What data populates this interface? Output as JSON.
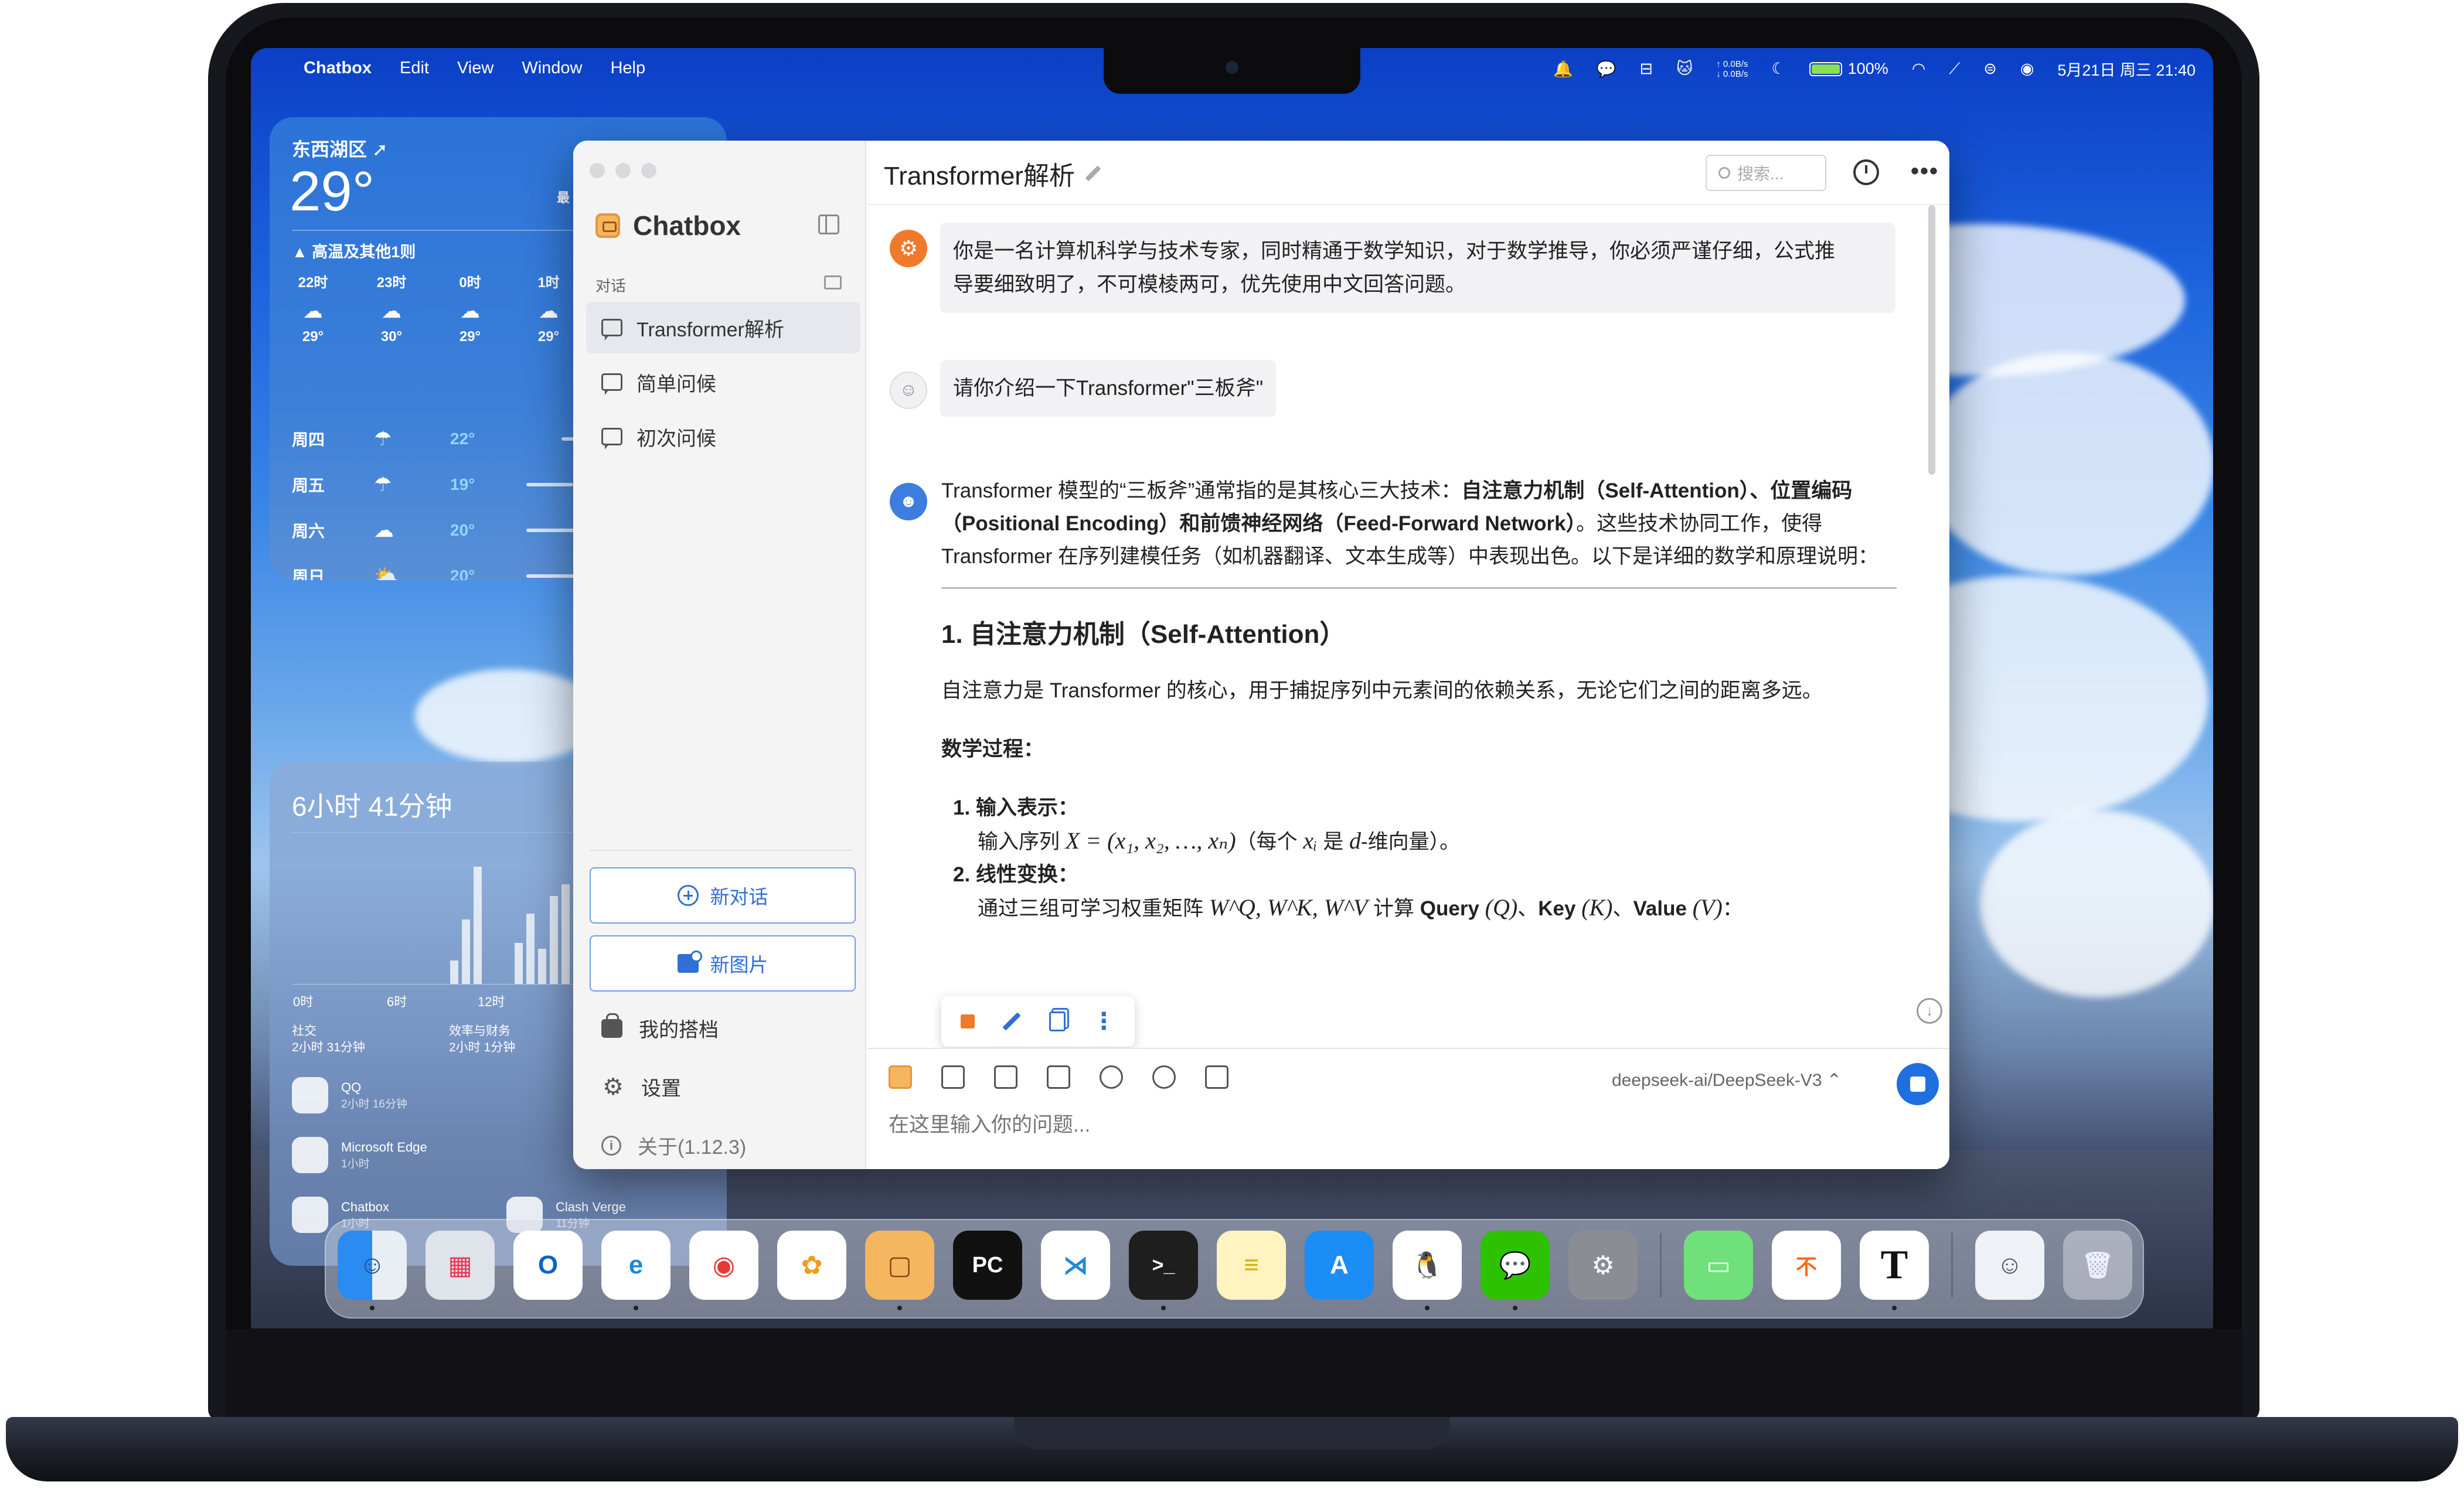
{
  "menubar": {
    "app_name": "Chatbox",
    "menus": [
      "Edit",
      "View",
      "Window",
      "Help"
    ],
    "net_up": "↑ 0.0B/s",
    "net_down": "↓ 0.0B/s",
    "battery": "100%",
    "datetime": "5月21日 周三  21:40"
  },
  "weather": {
    "location": "东西湖区 ➚",
    "temperature": "29°",
    "hilo_fragment": "最",
    "warning": "▲ 高温及其他1则",
    "hours": [
      {
        "time": "22时",
        "temp": "29°"
      },
      {
        "time": "23时",
        "temp": "30°"
      },
      {
        "time": "0时",
        "temp": "29°"
      },
      {
        "time": "1时",
        "temp": "29°"
      }
    ],
    "days": [
      {
        "day": "周四",
        "temp": "22°"
      },
      {
        "day": "周五",
        "temp": "19°"
      },
      {
        "day": "周六",
        "temp": "20°"
      },
      {
        "day": "周日",
        "temp": "20°"
      }
    ]
  },
  "screentime": {
    "title": "6小时 41分钟",
    "axis": [
      "0时",
      "6时",
      "12时"
    ],
    "cat1_name": "社交",
    "cat1_time": "2小时 31分钟",
    "cat2_name": "效率与财务",
    "cat2_time": "2小时 1分钟",
    "apps": [
      {
        "name": "QQ",
        "time": "2小时 16分钟"
      },
      {
        "name": "Microsoft Edge",
        "time": "1小时"
      },
      {
        "name": "Chatbox",
        "time": "1小时"
      },
      {
        "name": "Clash Verge",
        "time": "11分钟"
      }
    ]
  },
  "sidebar": {
    "brand": "Chatbox",
    "section_label": "对话",
    "conversations": [
      "Transformer解析",
      "简单问候",
      "初次问候"
    ],
    "new_chat": "新对话",
    "new_image": "新图片",
    "my_partners": "我的搭档",
    "settings": "设置",
    "about": "关于(1.12.3)"
  },
  "chat": {
    "title": "Transformer解析",
    "search_placeholder": "搜索...",
    "system_msg_line1": "你是一名计算机科学与技术专家，同时精通于数学知识，对于数学推导，你必须严谨仔细，公式推",
    "system_msg_line2": "导要细致明了，不可模棱两可，优先使用中文回答问题。",
    "user_msg": "请你介绍一下Transformer\"三板斧\"",
    "answer": {
      "intro_a": "Transformer 模型的“三板斧”通常指的是其核心三大技术：",
      "intro_b": "自注意力机制（Self-Attention）、位置编码（Positional Encoding）和前馈神经网络（Feed-Forward Network）",
      "intro_c": "。这些技术协同工作，使得 Transformer 在序列建模任务（如机器翻译、文本生成等）中表现出色。以下是详细的数学和原理说明：",
      "h1": "1. 自注意力机制（Self-Attention）",
      "p1": "自注意力是 Transformer 的核心，用于捕捉序列中元素间的依赖关系，无论它们之间的距离多远。",
      "h_math": "数学过程：",
      "item1_head": "1. 输入表示：",
      "item1_text_a": "输入序列 ",
      "item1_math": "X = (x₁, x₂, …, xₙ)",
      "item1_text_b": "（每个 ",
      "item1_math2": "xᵢ",
      "item1_text_c": " 是 ",
      "item1_math3": "d",
      "item1_text_d": "-维向量）。",
      "item2_head": "2. 线性变换：",
      "item2_text_a": "通过三组可学习权重矩阵 ",
      "item2_math": "W^Q, W^K, W^V",
      "item2_text_b": " 计算 ",
      "item2_q": "Query",
      "item2_qm": "(Q)",
      "item2_k": "Key",
      "item2_km": "(K)",
      "item2_v": "Value",
      "item2_vm": "(V)",
      "item2_end": "："
    },
    "model": "deepseek-ai/DeepSeek-V3 ⌃",
    "input_placeholder": "在这里输入你的问题..."
  },
  "dock": {
    "apps": [
      "Finder",
      "Launchpad",
      "Outlook",
      "Edge",
      "Chrome",
      "Photos",
      "Chatbox",
      "PyCharm",
      "VS Code",
      "Terminal",
      "Notes",
      "App Store",
      "QQ",
      "WeChat",
      "System Settings",
      "Battery",
      "不背单词",
      "Typora",
      "Avatar",
      "Trash"
    ]
  }
}
